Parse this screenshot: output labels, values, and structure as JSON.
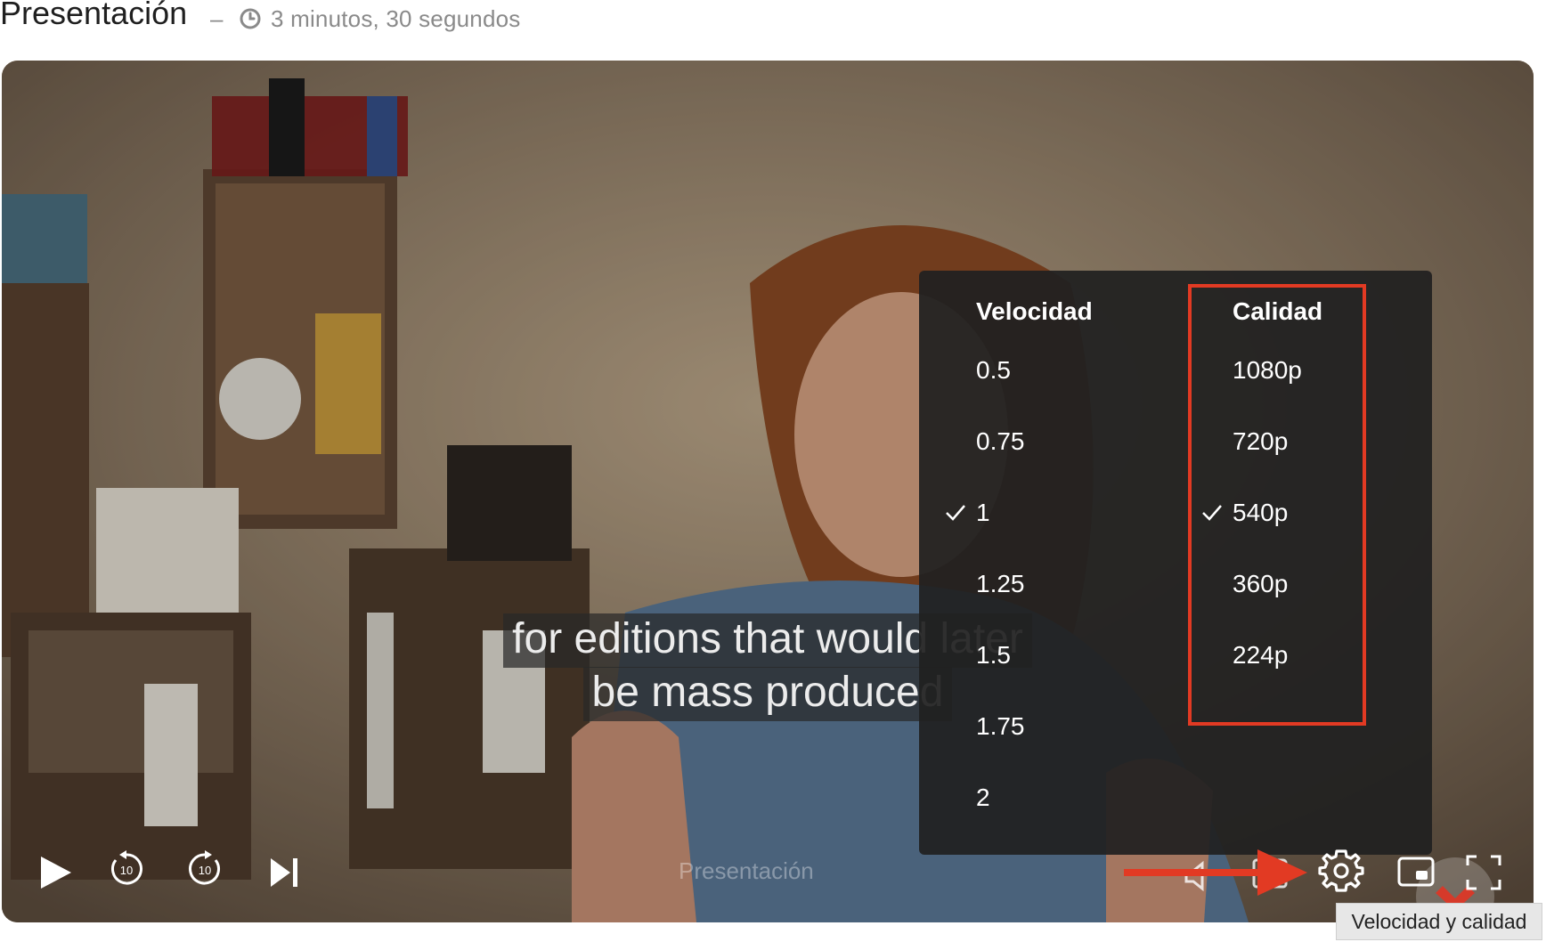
{
  "header": {
    "title": "Presentación",
    "separator": "–",
    "duration": "3 minutos, 30 segundos"
  },
  "video": {
    "caption_line1": "for editions that would later",
    "caption_line2": "be mass produced",
    "overlay_title": "Presentación"
  },
  "settings_menu": {
    "speed": {
      "title": "Velocidad",
      "options": [
        "0.5",
        "0.75",
        "1",
        "1.25",
        "1.5",
        "1.75",
        "2"
      ],
      "selected": "1"
    },
    "quality": {
      "title": "Calidad",
      "options": [
        "1080p",
        "720p",
        "540p",
        "360p",
        "224p"
      ],
      "selected": "540p"
    }
  },
  "controls": {
    "play": "play-icon",
    "rewind": "rewind-10-icon",
    "forward": "forward-10-icon",
    "next": "skip-next-icon",
    "volume": "volume-icon",
    "captions": "captions-icon",
    "settings": "gear-icon",
    "pip": "picture-in-picture-icon",
    "fullscreen": "fullscreen-icon",
    "rewind_label": "10",
    "forward_label": "10"
  },
  "tooltip": {
    "text": "Velocidad y calidad"
  },
  "colors": {
    "highlight": "#e23a23",
    "arrow": "#e23a23",
    "menu_bg": "#202020"
  }
}
